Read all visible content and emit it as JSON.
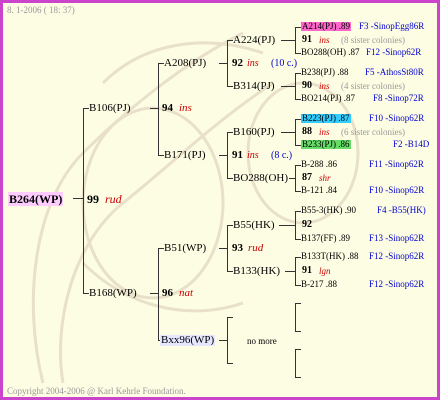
{
  "header": {
    "date": "8. 1-2006 ( 18: 37)"
  },
  "footer": {
    "copyright": "Copyright 2004-2006 @ Karl Kehrle Foundation."
  },
  "root": {
    "id": "B264(WP)",
    "score": "99",
    "name": "rud"
  },
  "gen1": [
    {
      "id": "B106(PJ)",
      "score": "94",
      "name": "ins"
    },
    {
      "id": "B168(WP)",
      "score": "96",
      "name": "nat"
    }
  ],
  "gen2": [
    {
      "id": "A208(PJ)",
      "score": "92",
      "name": "ins",
      "note": "(10 c.)"
    },
    {
      "id": "B171(PJ)",
      "score": "91",
      "name": "ins",
      "note": "(8 c.)"
    },
    {
      "id": "B51(WP)",
      "score": "93",
      "name": "rud",
      "note": ""
    },
    {
      "id": "Bxx96(WP)",
      "score": "",
      "name": "",
      "note": "no more"
    }
  ],
  "gen3": [
    {
      "id": "A224(PJ)"
    },
    {
      "id": "B314(PJ)"
    },
    {
      "id": "B160(PJ)"
    },
    {
      "id": "BO288(OH)",
      "score": "87",
      "name": "shr"
    },
    {
      "id": "B55(HK)"
    },
    {
      "id": "B133(HK)",
      "score": "91",
      "name": "lgn"
    }
  ],
  "gen4": [
    {
      "line1": "A214(PJ) .89",
      "line1b": "F3 -SinopEgg86R",
      "mid": "91",
      "midname": "ins",
      "midnote": "(8 sister colonies)",
      "line2": "BO288(OH) .87",
      "line2b": "F12 -Sinop62R"
    },
    {
      "line1": "B238(PJ) .88",
      "line1b": "F5 -AthosSt80R",
      "mid": "90",
      "midname": "ins",
      "midnote": "(4 sister colonies)",
      "line2": "BO214(PJ) .87",
      "line2b": "F8 -Sinop72R"
    },
    {
      "line1": "B223(PJ) .87",
      "line1b": "F10 -Sinop62R",
      "mid": "88",
      "midname": "ins",
      "midnote": "(6 sister colonies)",
      "line2": "B233(PJ) .86",
      "line2b": "F2 -B14D"
    },
    {
      "line1": "B-288 .86",
      "line1b": "F11 -Sinop62R",
      "line2": "B-121 .84",
      "line2b": "F10 -Sinop62R"
    },
    {
      "line1": "B55-3(HK) .90",
      "line1b": "F4 -B55(HK)",
      "mid": "92",
      "line2": "B137(FF) .89",
      "line2b": "F13 -Sinop62R"
    },
    {
      "line1": "B133T(HK) .88",
      "line1b": "F12 -Sinop62R",
      "line2": "B-217 .88",
      "line2b": "F12 -Sinop62R"
    }
  ]
}
